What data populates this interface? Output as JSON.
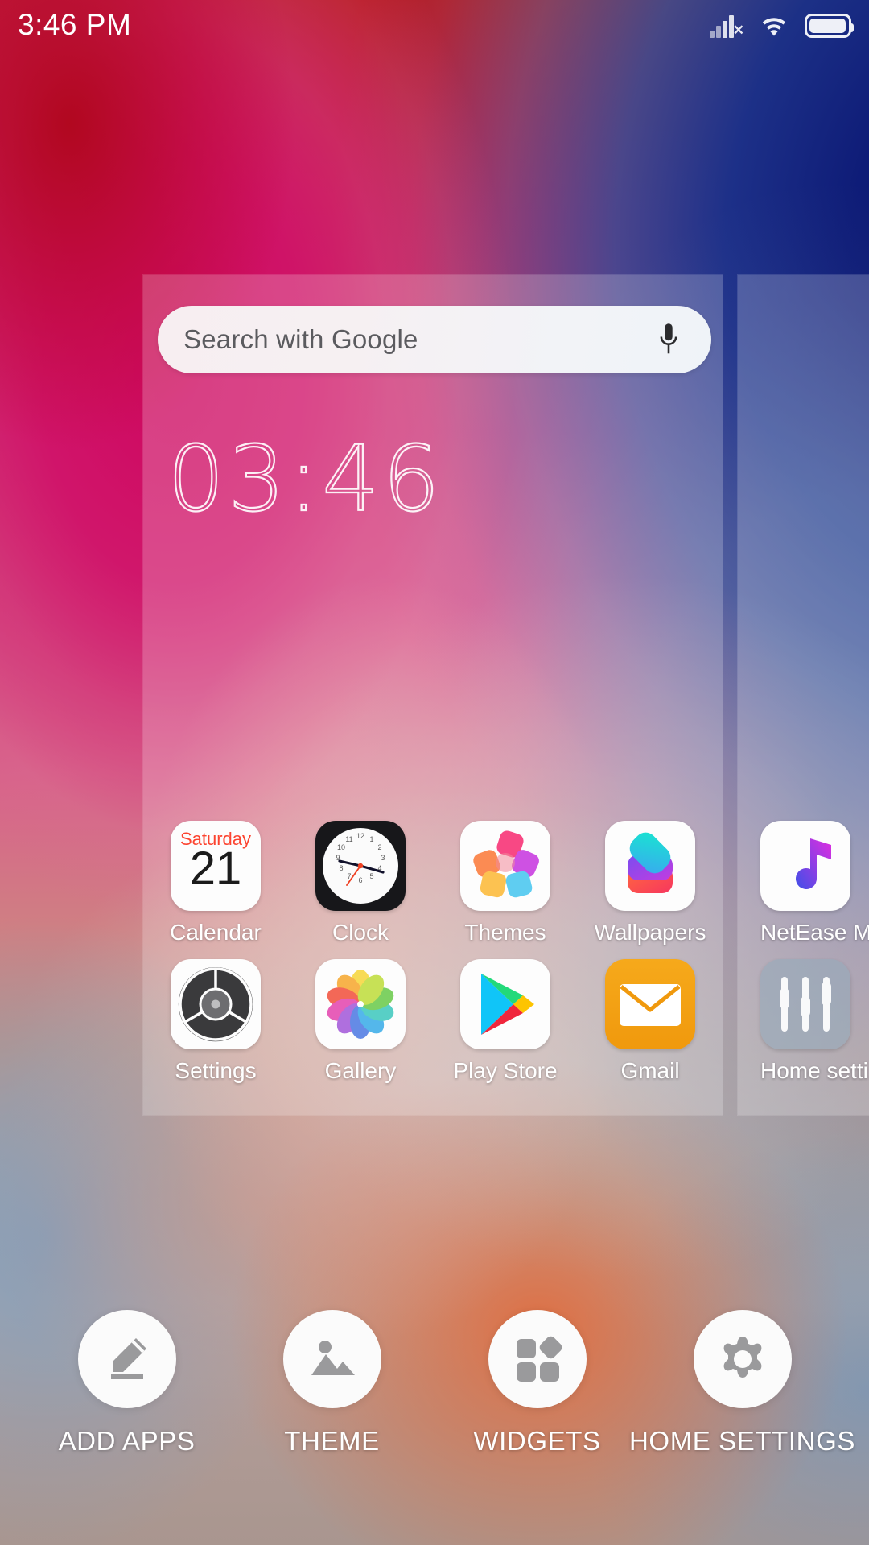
{
  "statusbar": {
    "time": "3:46 PM",
    "signal_icon": "signal-no-sim-icon",
    "wifi_icon": "wifi-icon",
    "battery_icon": "battery-icon"
  },
  "search": {
    "placeholder": "Search with Google",
    "mic_icon": "microphone-icon"
  },
  "clock_widget": {
    "time": "03:46"
  },
  "apps": {
    "row1": [
      {
        "label": "Calendar",
        "icon": "calendar-icon",
        "day": "Saturday",
        "date": "21"
      },
      {
        "label": "Clock",
        "icon": "clock-icon"
      },
      {
        "label": "Themes",
        "icon": "themes-icon"
      },
      {
        "label": "Wallpapers",
        "icon": "wallpapers-icon"
      }
    ],
    "row2": [
      {
        "label": "Settings",
        "icon": "settings-icon"
      },
      {
        "label": "Gallery",
        "icon": "gallery-icon"
      },
      {
        "label": "Play Store",
        "icon": "play-store-icon"
      },
      {
        "label": "Gmail",
        "icon": "gmail-icon"
      }
    ],
    "next_page": [
      {
        "label": "NetEase M...",
        "icon": "netease-music-icon"
      },
      {
        "label": "Home setti...",
        "icon": "home-settings-icon"
      }
    ]
  },
  "toolbar": [
    {
      "label": "ADD APPS",
      "icon": "pencil-icon"
    },
    {
      "label": "THEME",
      "icon": "image-icon"
    },
    {
      "label": "WIDGETS",
      "icon": "widgets-grid-icon"
    },
    {
      "label": "HOME SETTINGS",
      "icon": "gear-icon"
    }
  ],
  "colors": {
    "wallpaper_magenta": "#ce0860",
    "wallpaper_blue": "#0c1c78",
    "calendar_red": "#fc4430",
    "gmail_orange": "#f0990d"
  }
}
